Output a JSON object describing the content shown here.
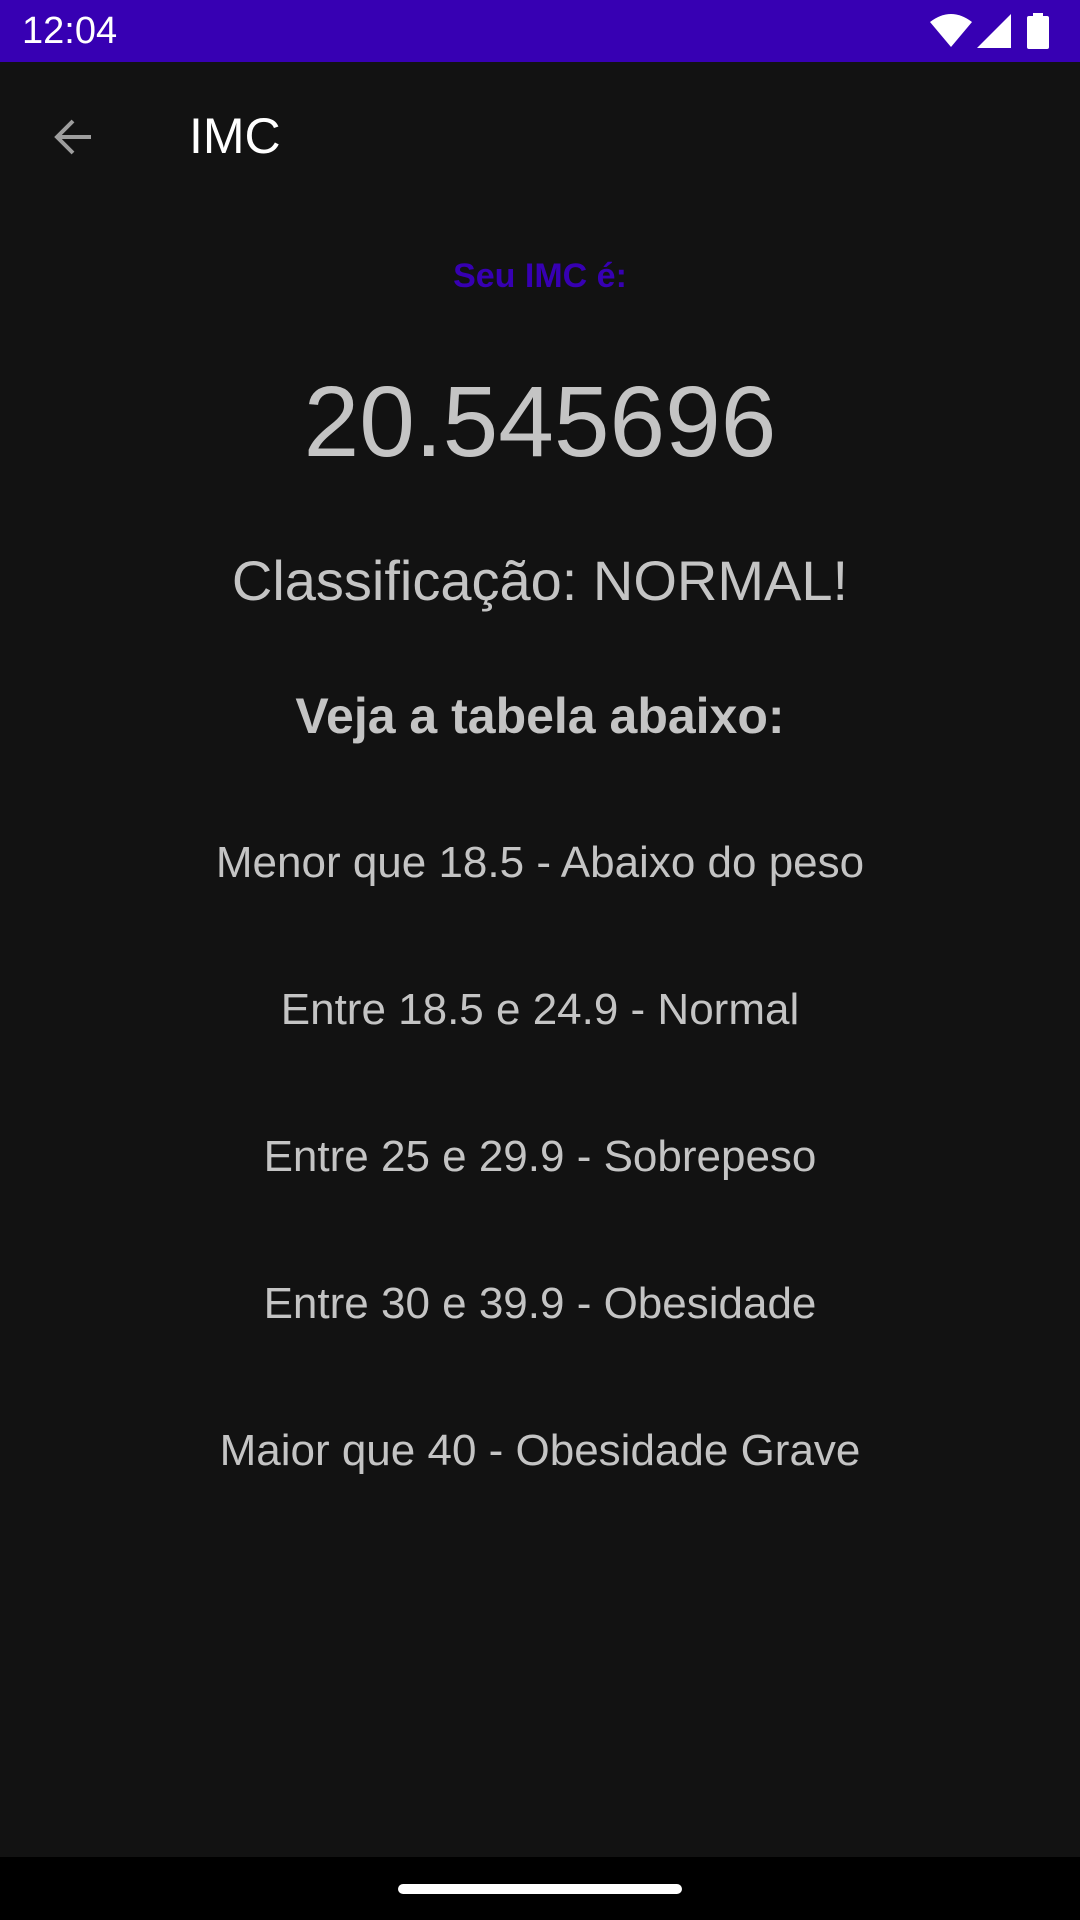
{
  "status_bar": {
    "time": "12:04",
    "icons": [
      "wifi-icon",
      "signal-icon",
      "battery-icon"
    ],
    "color": "#3700b3"
  },
  "toolbar": {
    "title": "IMC",
    "back_icon": "arrow-back-icon"
  },
  "result": {
    "label": "Seu IMC é:",
    "value": "20.545696",
    "classification": "Classificação: NORMAL!",
    "label_color": "#3700b3"
  },
  "table": {
    "heading": "Veja a tabela abaixo:",
    "rows": [
      "Menor que 18.5 - Abaixo do peso",
      "Entre 18.5 e 24.9 - Normal",
      "Entre 25 e 29.9 - Sobrepeso",
      "Entre 30 e 39.9 - Obesidade",
      "Maior que 40 - Obesidade Grave"
    ]
  },
  "theme": {
    "background": "#121212",
    "text": "#c4c4c4",
    "accent": "#3700b3"
  }
}
